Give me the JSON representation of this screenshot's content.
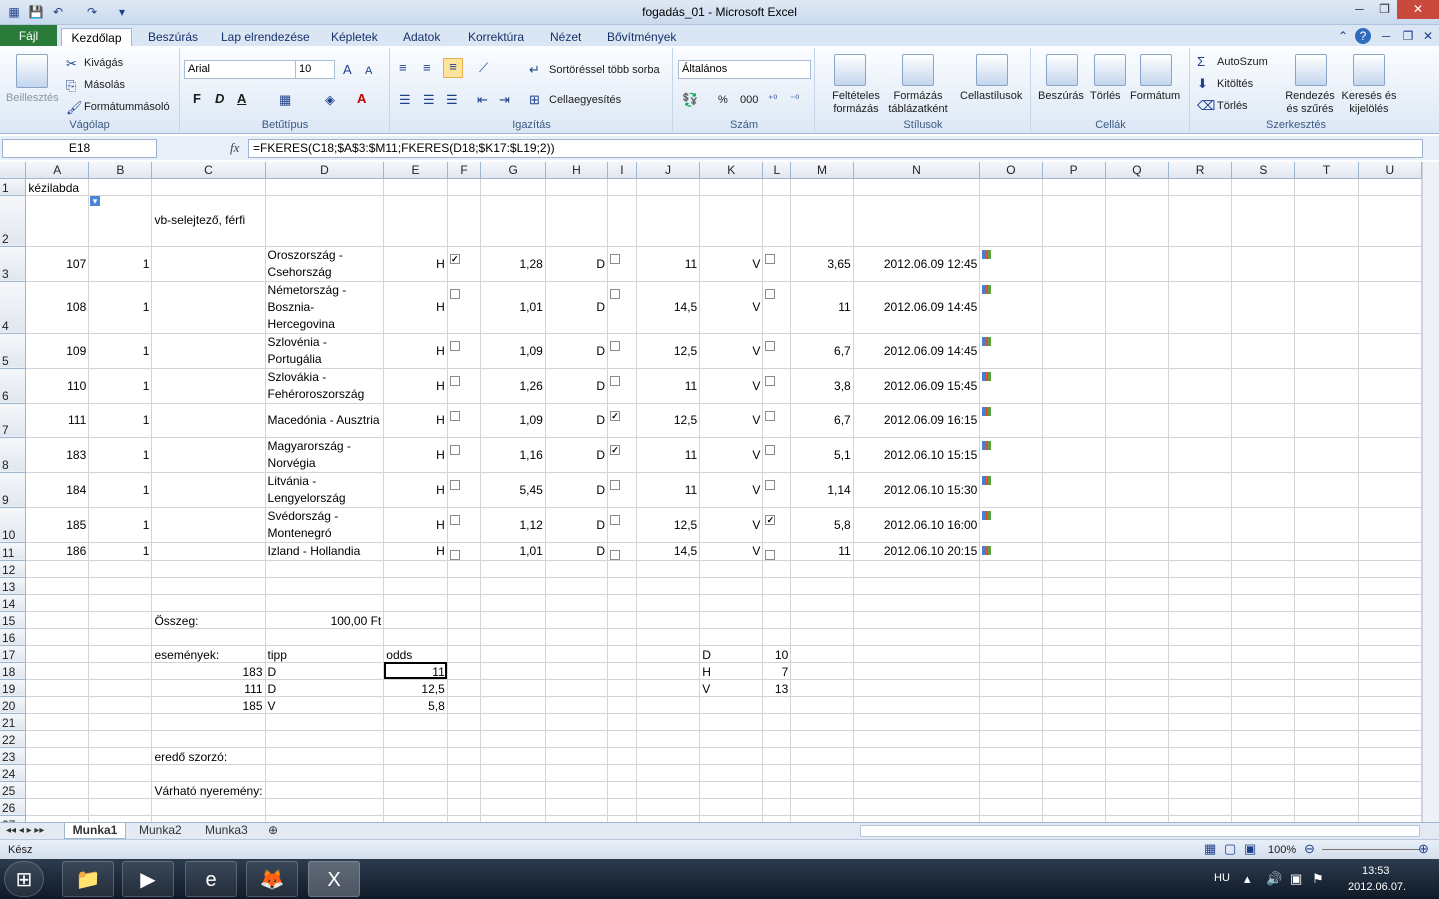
{
  "window": {
    "title": "fogadás_01  -  Microsoft Excel"
  },
  "ribbon_tabs": [
    "Fájl",
    "Kezdőlap",
    "Beszúrás",
    "Lap elrendezése",
    "Képletek",
    "Adatok",
    "Korrektúra",
    "Nézet",
    "Bővítmények"
  ],
  "ribbon": {
    "clipboard": {
      "label": "Vágólap",
      "paste": "Beillesztés",
      "cut": "Kivágás",
      "copy": "Másolás",
      "format_painter": "Formátummásoló"
    },
    "font": {
      "label": "Betűtípus",
      "font_name": "Arial",
      "font_size": "10",
      "bold": "F",
      "italic": "D",
      "underline": "A"
    },
    "alignment": {
      "label": "Igazítás",
      "wrap": "Sortöréssel több sorba",
      "merge": "Cellaegyesítés"
    },
    "number": {
      "label": "Szám",
      "format": "Általános",
      "percent": "%",
      "thousands": "000"
    },
    "styles": {
      "label": "Stílusok",
      "conditional": "Feltételes formázás",
      "as_table": "Formázás táblázatként",
      "cell_styles": "Cellastílusok"
    },
    "cells": {
      "label": "Cellák",
      "insert": "Beszúrás",
      "delete": "Törlés",
      "format": "Formátum"
    },
    "editing": {
      "label": "Szerkesztés",
      "autosum": "AutoSzum",
      "fill": "Kitöltés",
      "clear": "Törlés",
      "sort": "Rendezés és szűrés",
      "find": "Keresés és kijelölés"
    }
  },
  "formula_bar": {
    "name_box": "E18",
    "fx": "fx",
    "formula": "=FKERES(C18;$A$3:$M11;FKERES(D18;$K17:$L19;2))"
  },
  "columns": [
    "A",
    "B",
    "C",
    "D",
    "E",
    "F",
    "G",
    "H",
    "I",
    "J",
    "K",
    "L",
    "M",
    "N",
    "O",
    "P",
    "Q",
    "R",
    "S",
    "T",
    "U"
  ],
  "rows": {
    "r1": {
      "n": "1",
      "A": "kézilabda"
    },
    "r2": {
      "n": "2",
      "C": "vb-selejtező, férfi"
    },
    "matches": [
      {
        "n": "3",
        "A": "107",
        "B": "1",
        "D": "Oroszország - Csehország",
        "E": "H",
        "F": true,
        "G": "1,28",
        "H": "D",
        "I": false,
        "J": "11",
        "K": "V",
        "L": false,
        "M": "3,65",
        "N": "2012.06.09 12:45"
      },
      {
        "n": "4",
        "A": "108",
        "B": "1",
        "D": "Németország - Bosznia-Hercegovina",
        "E": "H",
        "F": false,
        "G": "1,01",
        "H": "D",
        "I": false,
        "J": "14,5",
        "K": "V",
        "L": false,
        "M": "11",
        "N": "2012.06.09 14:45"
      },
      {
        "n": "5",
        "A": "109",
        "B": "1",
        "D": "Szlovénia - Portugália",
        "E": "H",
        "F": false,
        "G": "1,09",
        "H": "D",
        "I": false,
        "J": "12,5",
        "K": "V",
        "L": false,
        "M": "6,7",
        "N": "2012.06.09 14:45"
      },
      {
        "n": "6",
        "A": "110",
        "B": "1",
        "D": "Szlovákia - Fehéroroszország",
        "E": "H",
        "F": false,
        "G": "1,26",
        "H": "D",
        "I": false,
        "J": "11",
        "K": "V",
        "L": false,
        "M": "3,8",
        "N": "2012.06.09 15:45"
      },
      {
        "n": "7",
        "A": "111",
        "B": "1",
        "D": "Macedónia - Ausztria",
        "E": "H",
        "F": false,
        "G": "1,09",
        "H": "D",
        "I": true,
        "J": "12,5",
        "K": "V",
        "L": false,
        "M": "6,7",
        "N": "2012.06.09 16:15"
      },
      {
        "n": "8",
        "A": "183",
        "B": "1",
        "D": "Magyarország - Norvégia",
        "E": "H",
        "F": false,
        "G": "1,16",
        "H": "D",
        "I": true,
        "J": "11",
        "K": "V",
        "L": false,
        "M": "5,1",
        "N": "2012.06.10 15:15"
      },
      {
        "n": "9",
        "A": "184",
        "B": "1",
        "D": "Litvánia - Lengyelország",
        "E": "H",
        "F": false,
        "G": "5,45",
        "H": "D",
        "I": false,
        "J": "11",
        "K": "V",
        "L": false,
        "M": "1,14",
        "N": "2012.06.10 15:30"
      },
      {
        "n": "10",
        "A": "185",
        "B": "1",
        "D": "Svédország - Montenegró",
        "E": "H",
        "F": false,
        "G": "1,12",
        "H": "D",
        "I": false,
        "J": "12,5",
        "K": "V",
        "L": true,
        "M": "5,8",
        "N": "2012.06.10 16:00"
      },
      {
        "n": "11",
        "A": "186",
        "B": "1",
        "D": "Izland - Hollandia",
        "E": "H",
        "F": false,
        "G": "1,01",
        "H": "D",
        "I": false,
        "J": "14,5",
        "K": "V",
        "L": false,
        "M": "11",
        "N": "2012.06.10 20:15"
      }
    ],
    "sum_label": "Összeg:",
    "sum_value": "100,00 Ft",
    "events_label": "események:",
    "tip_header": "tipp",
    "odds_header": "odds",
    "events": [
      {
        "n": "18",
        "C": "183",
        "D": "D",
        "E": "11",
        "K": "H",
        "L": "7"
      },
      {
        "n": "19",
        "C": "111",
        "D": "D",
        "E": "12,5",
        "K": "V",
        "L": "13"
      },
      {
        "n": "20",
        "C": "185",
        "D": "V",
        "E": "5,8"
      }
    ],
    "lookup_first": {
      "K": "D",
      "L": "10"
    },
    "result_label": "eredő szorzó:",
    "expected_label": "Várható nyeremény:"
  },
  "sheet_tabs": [
    "Munka1",
    "Munka2",
    "Munka3"
  ],
  "status": {
    "ready": "Kész",
    "zoom": "100%"
  },
  "taskbar": {
    "lang": "HU",
    "time": "13:53",
    "date": "2012.06.07."
  }
}
